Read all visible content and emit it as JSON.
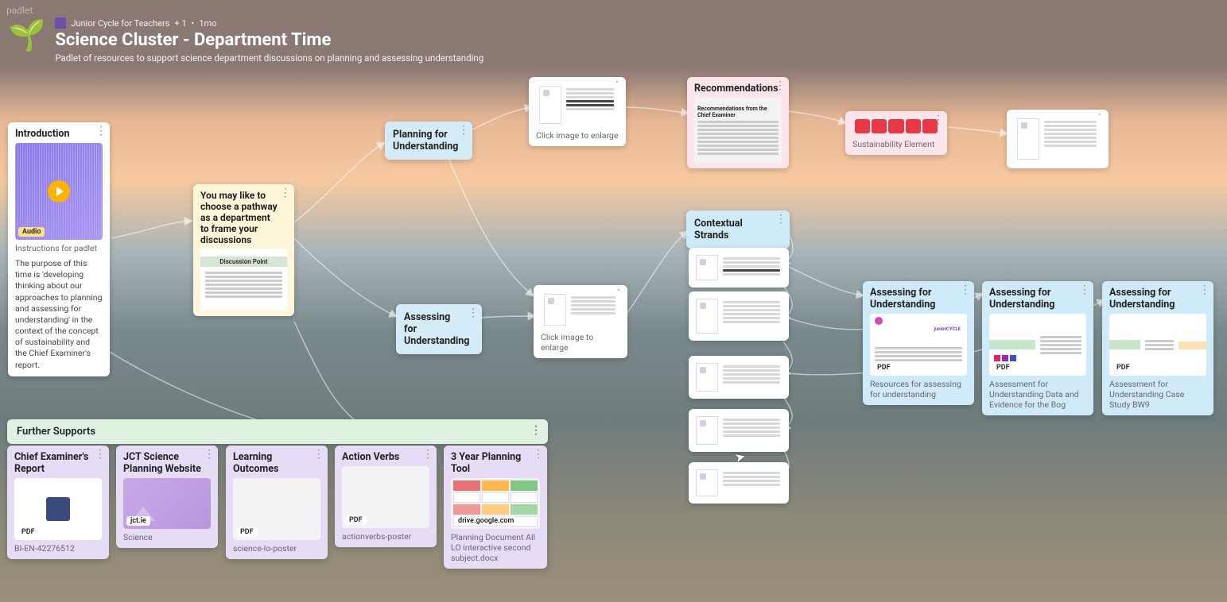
{
  "app": {
    "watermark": "padlet"
  },
  "header": {
    "author": "Junior Cycle for Teachers",
    "extra": "+ 1",
    "sep": "•",
    "age": "1mo",
    "title": "Science Cluster - Department Time",
    "subtitle": "Padlet of resources to support science department discussions on planning and assessing understanding"
  },
  "cards": {
    "intro": {
      "title": "Introduction",
      "audio_badge": "Audio",
      "caption1": "Instructions for padlet",
      "body": "The purpose of this time is 'developing thinking about our approaches to planning and assessing for understanding' in the context of the concept of sustainability and the Chief Examiner's report."
    },
    "pathway": {
      "title": "You may like to choose a pathway as a department to frame your discussions",
      "discussion_label": "Discussion Point"
    },
    "planning": {
      "title": "Planning for Understanding"
    },
    "planning_img": {
      "caption": "Click image to enlarge"
    },
    "recommendations": {
      "title": "Recommendations",
      "sub": "Recommendations from the Chief Examiner"
    },
    "sustain": {
      "caption": "Sustainability Element"
    },
    "assessing": {
      "title": "Assessing for Understanding"
    },
    "assessing_img": {
      "caption": "Click image to enlarge"
    },
    "contextual": {
      "title": "Contextual Strands"
    },
    "assess_pdf1": {
      "title": "Assessing for Understanding",
      "badge": "PDF",
      "caption": "Resources for assessing for understanding"
    },
    "assess_pdf2": {
      "title": "Assessing for Understanding",
      "badge": "PDF",
      "caption": "Assessment for Understanding Data and Evidence for the Bog"
    },
    "assess_pdf3": {
      "title": "Assessing for Understanding",
      "badge": "PDF",
      "caption": "Assessment for Understanding Case Study BW9"
    },
    "further": {
      "title": "Further Supports"
    },
    "chief": {
      "title": "Chief Examiner's Report",
      "badge": "PDF",
      "caption": "BI-EN-42276512"
    },
    "jct": {
      "title": "JCT Science Planning Website",
      "domain": "jct.ie",
      "caption": "Science"
    },
    "lo": {
      "title": "Learning Outcomes",
      "badge": "PDF",
      "caption": "science-lo-poster"
    },
    "verbs": {
      "title": "Action Verbs",
      "badge": "PDF",
      "caption": "actionverbs-poster"
    },
    "plan3": {
      "title": "3 Year Planning Tool",
      "domain": "drive.google.com",
      "caption": "Planning Document All LO interactive second subject.docx"
    }
  }
}
